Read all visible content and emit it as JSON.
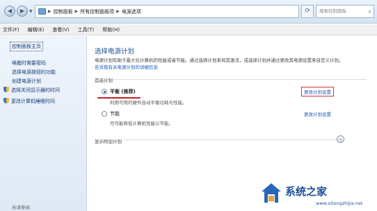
{
  "address_bar": {
    "crumbs": [
      "控制面板",
      "所有控制面板项",
      "电源选项"
    ],
    "search_placeholder": "搜索控制面板"
  },
  "menu": [
    "文件(F)",
    "编辑(E)",
    "查看(V)",
    "工具(T)",
    "帮助(H)"
  ],
  "sidebar": {
    "home": "控制面板主页",
    "links": [
      "唤醒时需要密码",
      "选择电源按钮的功能",
      "创建电源计划",
      "选择关闭显示器的时间",
      "更改计算机睡眠时间"
    ],
    "see_also": "另请参阅"
  },
  "main": {
    "title": "选择电源计划",
    "description_part1": "电源计划有助于最大化计算机的性能或者节能。通过选择计划来将其激活，或选择计划并通过更改其电源设置来自定义计划。",
    "description_link": "告诉我有关电源计划的详细信息",
    "section_label": "首选计划",
    "plans": [
      {
        "name": "平衡 (推荐)",
        "description": "利用可用的硬件自动平衡功耗与性能。",
        "link": "更改计划设置",
        "selected": true
      },
      {
        "name": "节能",
        "description": "尽可能降低计算机性能以节能。",
        "link": "更改计划设置",
        "selected": false
      }
    ],
    "show_more": "显示附加计划"
  },
  "watermark": {
    "title": "系统之家",
    "url": "www.xitongzhijia.net"
  },
  "colors": {
    "accent_blue": "#1e4f8f",
    "link_blue": "#1a57b6",
    "highlight_red": "#c81e1e"
  }
}
